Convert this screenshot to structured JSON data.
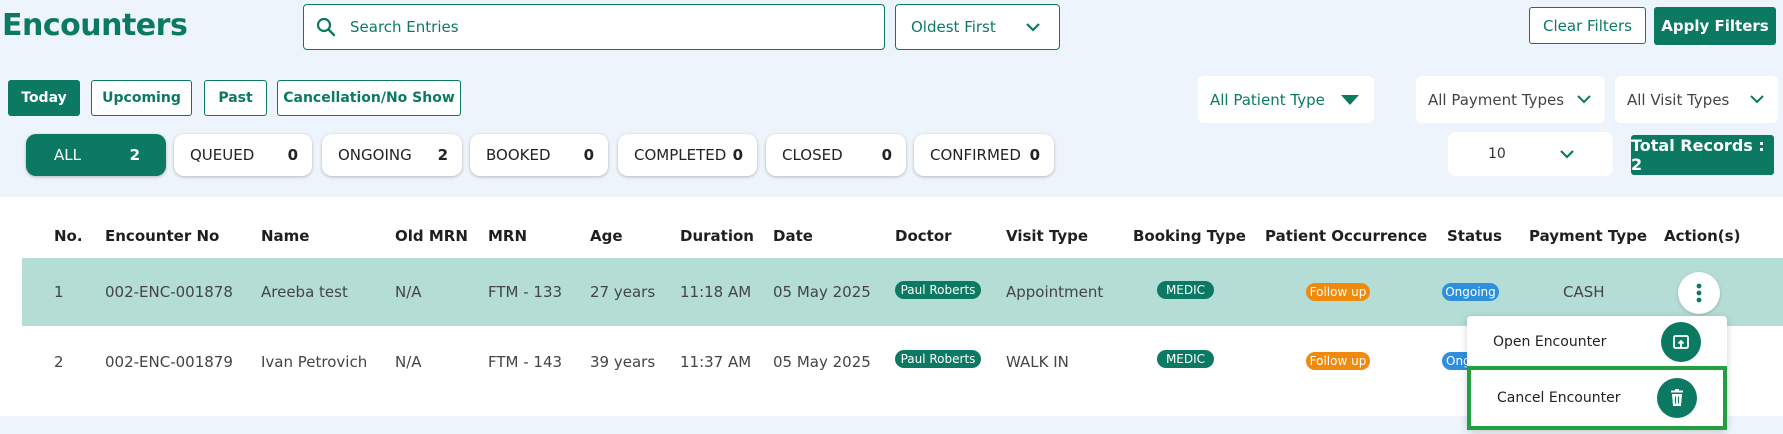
{
  "header": {
    "title": "Encounters",
    "search_placeholder": "Search Entries",
    "sort_value": "Oldest First",
    "clear_filters": "Clear Filters",
    "apply_filters": "Apply Filters"
  },
  "tabs": [
    "Today",
    "Upcoming",
    "Past",
    "Cancellation/No Show"
  ],
  "filters": {
    "patient_type": "All Patient Type",
    "payment_types": "All Payment Types",
    "visit_types": "All Visit Types"
  },
  "status_counts": [
    {
      "label": "ALL",
      "count": "2"
    },
    {
      "label": "QUEUED",
      "count": "0"
    },
    {
      "label": "ONGOING",
      "count": "2"
    },
    {
      "label": "BOOKED",
      "count": "0"
    },
    {
      "label": "COMPLETED",
      "count": "0"
    },
    {
      "label": "CLOSED",
      "count": "0"
    },
    {
      "label": "CONFIRMED",
      "count": "0"
    }
  ],
  "pagination": {
    "page_size": "10",
    "total_records": "Total Records : 2"
  },
  "table": {
    "headers": [
      "No.",
      "Encounter No",
      "Name",
      "Old MRN",
      "MRN",
      "Age",
      "Duration",
      "Date",
      "Doctor",
      "Visit Type",
      "Booking Type",
      "Patient Occurrence",
      "Status",
      "Payment Type",
      "Action(s)"
    ],
    "rows": [
      {
        "no": "1",
        "encounter_no": "002-ENC-001878",
        "name": "Areeba test",
        "old_mrn": "N/A",
        "mrn": "FTM - 133",
        "age": "27 years",
        "duration": "11:18 AM",
        "date": "05 May 2025",
        "doctor": "Paul Roberts",
        "visit_type": "Appointment",
        "booking_type": "MEDIC",
        "occurrence": "Follow up",
        "status": "Ongoing",
        "payment_type": "CASH"
      },
      {
        "no": "2",
        "encounter_no": "002-ENC-001879",
        "name": "Ivan Petrovich",
        "old_mrn": "N/A",
        "mrn": "FTM - 143",
        "age": "39 years",
        "duration": "11:37 AM",
        "date": "05 May 2025",
        "doctor": "Paul Roberts",
        "visit_type": "WALK IN",
        "booking_type": "MEDIC",
        "occurrence": "Follow up",
        "status": "Ong",
        "payment_type": ""
      }
    ]
  },
  "action_menu": {
    "open": "Open Encounter",
    "cancel": "Cancel Encounter"
  },
  "colors": {
    "brand": "#0c7a63",
    "selected_row": "#b4ddd5",
    "follow_up": "#f08a0c",
    "status_ongoing": "#2f8fde",
    "highlight": "#22a041"
  }
}
